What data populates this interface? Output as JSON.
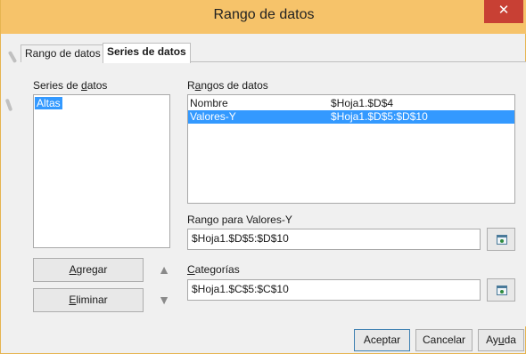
{
  "window": {
    "title": "Rango de datos",
    "close_symbol": "✕"
  },
  "tabs": [
    {
      "label": "Rango de datos",
      "active": false
    },
    {
      "label": "Series de datos",
      "active": true
    }
  ],
  "series_panel": {
    "label_prefix": "Series de ",
    "label_mnemonic": "d",
    "label_suffix": "atos",
    "items": [
      "Altas"
    ],
    "selected_index": 0
  },
  "ranges_panel": {
    "label_prefix": "R",
    "label_mnemonic": "a",
    "label_suffix": "ngos de datos",
    "rows": [
      {
        "name": "Nombre",
        "range": "$Hoja1.$D$4",
        "selected": false
      },
      {
        "name": "Valores-Y",
        "range": "$Hoja1.$D$5:$D$10",
        "selected": true
      }
    ]
  },
  "y_range": {
    "label_prefix": "Ran",
    "label_mnemonic": "g",
    "label_suffix": "o para Valores-Y",
    "value": "$Hoja1.$D$5:$D$10"
  },
  "categories": {
    "label_prefix": "",
    "label_mnemonic": "C",
    "label_suffix": "ategorías",
    "value": "$Hoja1.$C$5:$C$10"
  },
  "buttons": {
    "add_prefix": "",
    "add_mnemonic": "A",
    "add_suffix": "gregar",
    "remove_prefix": "",
    "remove_mnemonic": "E",
    "remove_suffix": "liminar",
    "up_symbol": "▲",
    "down_symbol": "▼",
    "ok": "Aceptar",
    "cancel": "Cancelar",
    "help_prefix": "Ay",
    "help_mnemonic": "u",
    "help_suffix": "da"
  },
  "colors": {
    "titlebar": "#f6c36a",
    "close": "#c84034",
    "selection": "#3399ff"
  }
}
